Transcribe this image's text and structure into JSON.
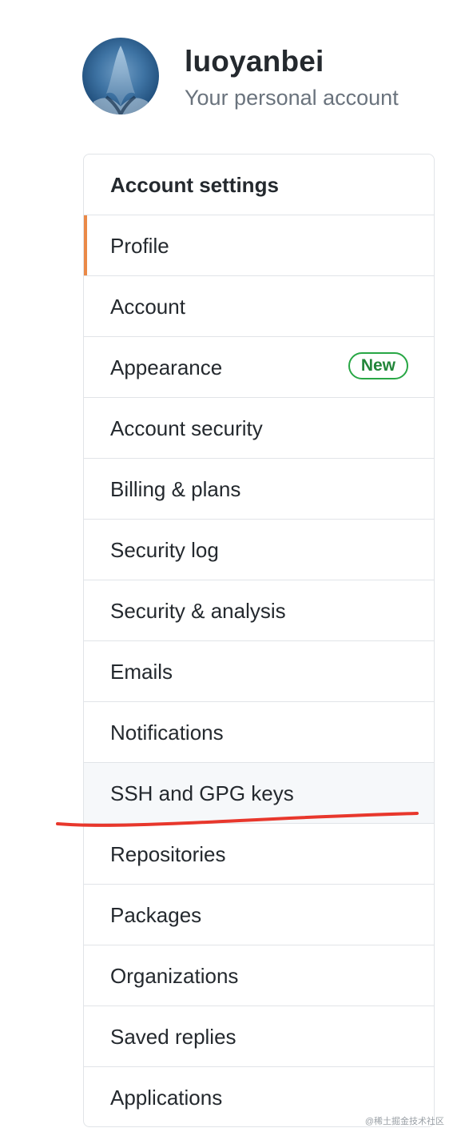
{
  "user": {
    "username": "luoyanbei",
    "subtitle": "Your personal account"
  },
  "menu": {
    "heading": "Account settings",
    "items": [
      {
        "label": "Profile"
      },
      {
        "label": "Account"
      },
      {
        "label": "Appearance",
        "badge": "New"
      },
      {
        "label": "Account security"
      },
      {
        "label": "Billing & plans"
      },
      {
        "label": "Security log"
      },
      {
        "label": "Security & analysis"
      },
      {
        "label": "Emails"
      },
      {
        "label": "Notifications"
      },
      {
        "label": "SSH and GPG keys"
      },
      {
        "label": "Repositories"
      },
      {
        "label": "Packages"
      },
      {
        "label": "Organizations"
      },
      {
        "label": "Saved replies"
      },
      {
        "label": "Applications"
      }
    ],
    "selected_item": "Profile",
    "hovered_item": "SSH and GPG keys"
  },
  "annotation": {
    "type": "red-underline",
    "target": "SSH and GPG keys",
    "color": "#e8372c"
  },
  "watermark": "@稀土掘金技术社区",
  "colors": {
    "selected_indicator": "#e36209",
    "badge_border": "#28a745",
    "badge_text": "#22863a",
    "border": "#e1e4e8",
    "muted_text": "#6a737d"
  }
}
